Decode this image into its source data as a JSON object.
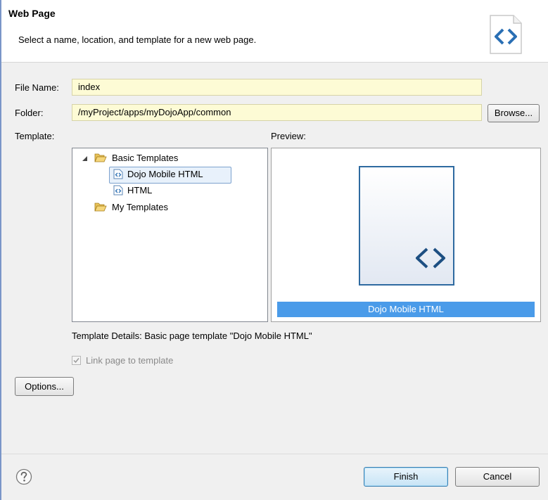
{
  "header": {
    "title": "Web Page",
    "description": "Select a name, location, and template for a new web page.",
    "icon": "html-file-icon"
  },
  "form": {
    "file_name_label": "File Name:",
    "file_name_value": "index",
    "folder_label": "Folder:",
    "folder_value": "/myProject/apps/myDojoApp/common",
    "browse_label": "Browse...",
    "template_label": "Template:",
    "preview_label": "Preview:"
  },
  "tree": {
    "items": [
      {
        "label": "Basic Templates",
        "icon": "folder-open-icon",
        "expanded": true
      },
      {
        "label": "Dojo Mobile HTML",
        "icon": "html-template-icon",
        "selected": true
      },
      {
        "label": "HTML",
        "icon": "html-template-icon"
      },
      {
        "label": "My Templates",
        "icon": "folder-open-icon"
      }
    ]
  },
  "preview": {
    "caption": "Dojo Mobile HTML"
  },
  "details": {
    "text": "Template Details:  Basic page template \"Dojo Mobile HTML\""
  },
  "link": {
    "label": "Link page to template",
    "checked": true
  },
  "buttons": {
    "options": "Options...",
    "finish": "Finish",
    "cancel": "Cancel"
  },
  "colors": {
    "accent": "#4a9be9",
    "field_bg": "#fdfbd5",
    "dialog_bg": "#f0f0f0"
  }
}
